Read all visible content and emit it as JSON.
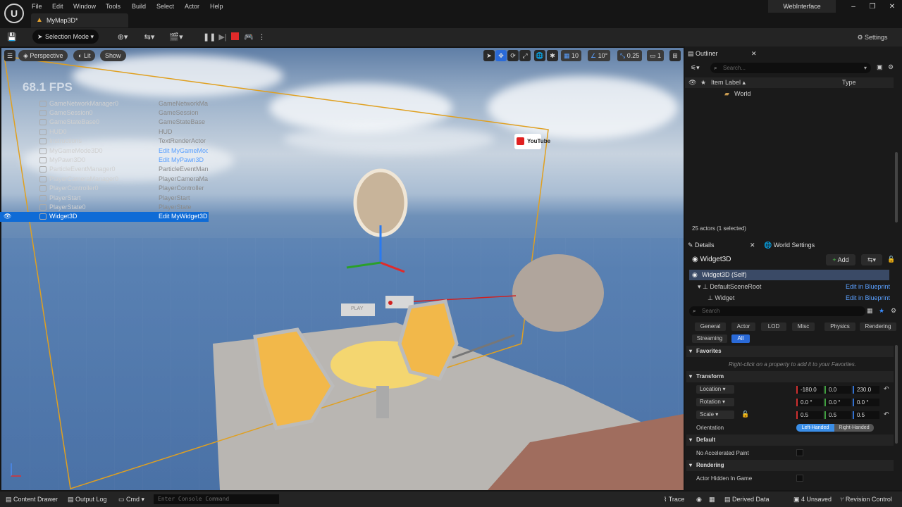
{
  "menu": [
    "File",
    "Edit",
    "Window",
    "Tools",
    "Build",
    "Select",
    "Actor",
    "Help"
  ],
  "map_tab": "MyMap3D*",
  "project_name": "WebInterface",
  "toolbar": {
    "selection_mode": "Selection Mode",
    "settings": "Settings"
  },
  "viewport": {
    "perspective": "Perspective",
    "lit": "Lit",
    "show": "Show",
    "fps": "68.1 FPS",
    "grid_snap": "10",
    "rot_snap": "10°",
    "scale_snap": "0.25",
    "camera_speed": "1",
    "youtube": "YouTube",
    "play_label": "PLAY"
  },
  "outliner": {
    "title": "Outliner",
    "search_placeholder": "Search...",
    "col_label": "Item Label ▴",
    "col_type": "Type",
    "world": "World",
    "rows": [
      {
        "label": "GameNetworkManager0",
        "type": "GameNetworkMan",
        "link": false
      },
      {
        "label": "GameSession0",
        "type": "GameSession",
        "link": false
      },
      {
        "label": "GameStateBase0",
        "type": "GameStateBase",
        "link": false
      },
      {
        "label": "HUD0",
        "type": "HUD",
        "link": false
      },
      {
        "label": "Instructions",
        "type": "TextRenderActor",
        "link": false
      },
      {
        "label": "MyGameMode3D0",
        "type": "Edit MyGameMod",
        "link": true
      },
      {
        "label": "MyPawn3D0",
        "type": "Edit MyPawn3D",
        "link": true
      },
      {
        "label": "ParticleEventManager0",
        "type": "ParticleEventMana",
        "link": false
      },
      {
        "label": "PlayerCameraManager0",
        "type": "PlayerCameraMan",
        "link": false
      },
      {
        "label": "PlayerController0",
        "type": "PlayerController",
        "link": false
      },
      {
        "label": "PlayerStart",
        "type": "PlayerStart",
        "link": false
      },
      {
        "label": "PlayerState0",
        "type": "PlayerState",
        "link": false
      },
      {
        "label": "Widget3D",
        "type": "Edit MyWidget3D",
        "link": true
      }
    ],
    "status": "25 actors (1 selected)"
  },
  "details": {
    "tab": "Details",
    "tab2": "World Settings",
    "actor": "Widget3D",
    "add": "Add",
    "self": "Widget3D (Self)",
    "root": "DefaultSceneRoot",
    "widget": "Widget",
    "edit_bp": "Edit in Blueprint",
    "search_placeholder": "Search",
    "filters": [
      "General",
      "Actor",
      "LOD",
      "Misc",
      "Physics",
      "Rendering",
      "Streaming",
      "All"
    ],
    "favorites": "Favorites",
    "fav_hint": "Right-click on a property to add it to your Favorites.",
    "transform": "Transform",
    "location": "Location",
    "loc": [
      "-180.0",
      "0.0",
      "230.0"
    ],
    "rotation": "Rotation",
    "rot": [
      "0.0 °",
      "0.0 °",
      "0.0 °"
    ],
    "scale": "Scale",
    "scl": [
      "0.5",
      "0.5",
      "0.5"
    ],
    "orientation": "Orientation",
    "left_handed": "Left-Handed",
    "right_handed": "Right-Handed",
    "default": "Default",
    "no_accel": "No Accelerated Paint",
    "rendering": "Rendering",
    "hidden": "Actor Hidden In Game"
  },
  "status": {
    "content_drawer": "Content Drawer",
    "output_log": "Output Log",
    "cmd": "Cmd",
    "console_placeholder": "Enter Console Command",
    "trace": "Trace",
    "derived": "Derived Data",
    "unsaved": "4 Unsaved",
    "revision": "Revision Control"
  }
}
